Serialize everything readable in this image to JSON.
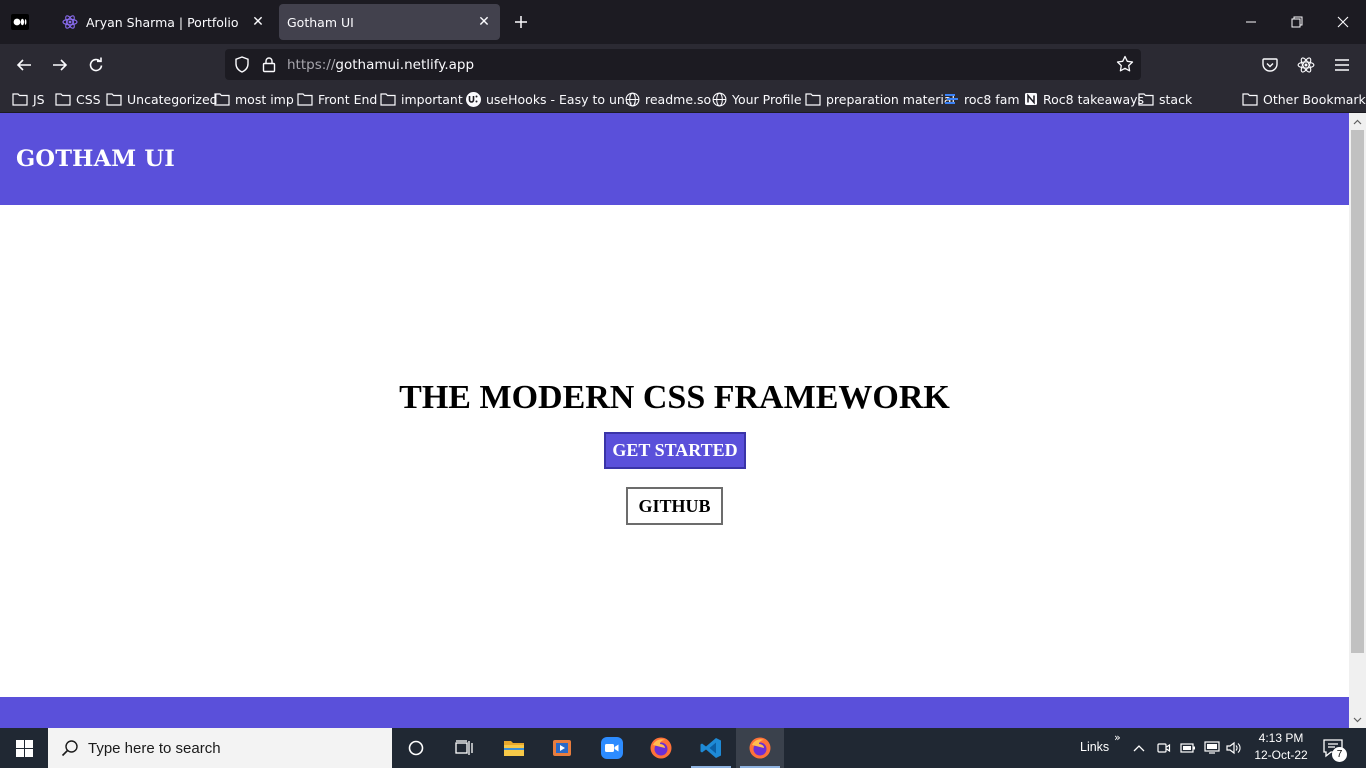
{
  "browser": {
    "tabs": [
      {
        "title": "Aryan Sharma | Portfolio",
        "active": false,
        "icon": "react-icon"
      },
      {
        "title": "Gotham UI",
        "active": true,
        "icon": "none"
      }
    ],
    "url_scheme": "https://",
    "url_host": "gothamui.netlify.app",
    "bookmarks": [
      {
        "label": "JS",
        "icon": "folder-icon"
      },
      {
        "label": "CSS",
        "icon": "folder-icon"
      },
      {
        "label": "Uncategorized",
        "icon": "folder-icon"
      },
      {
        "label": "most imp",
        "icon": "folder-icon"
      },
      {
        "label": "Front End",
        "icon": "folder-icon"
      },
      {
        "label": "important",
        "icon": "folder-icon"
      },
      {
        "label": "useHooks - Easy to un...",
        "icon": "usehooks-icon"
      },
      {
        "label": "readme.so",
        "icon": "globe-icon"
      },
      {
        "label": "Your Profile",
        "icon": "globe-icon"
      },
      {
        "label": "preparation material",
        "icon": "folder-icon"
      },
      {
        "label": "roc8 fam",
        "icon": "stack-icon"
      },
      {
        "label": "Roc8 takeaways",
        "icon": "notion-icon"
      },
      {
        "label": "stack",
        "icon": "folder-icon"
      }
    ],
    "other_bookmarks": "Other Bookmarks"
  },
  "page": {
    "brand": "GOTHAM UI",
    "hero_title": "THE MODERN CSS FRAMEWORK",
    "primary_button": "GET STARTED",
    "secondary_button": "GITHUB",
    "accent_color": "#5a50da"
  },
  "taskbar": {
    "search_placeholder": "Type here to search",
    "links_label": "Links",
    "time": "4:13 PM",
    "date": "12-Oct-22",
    "notification_count": "7"
  }
}
